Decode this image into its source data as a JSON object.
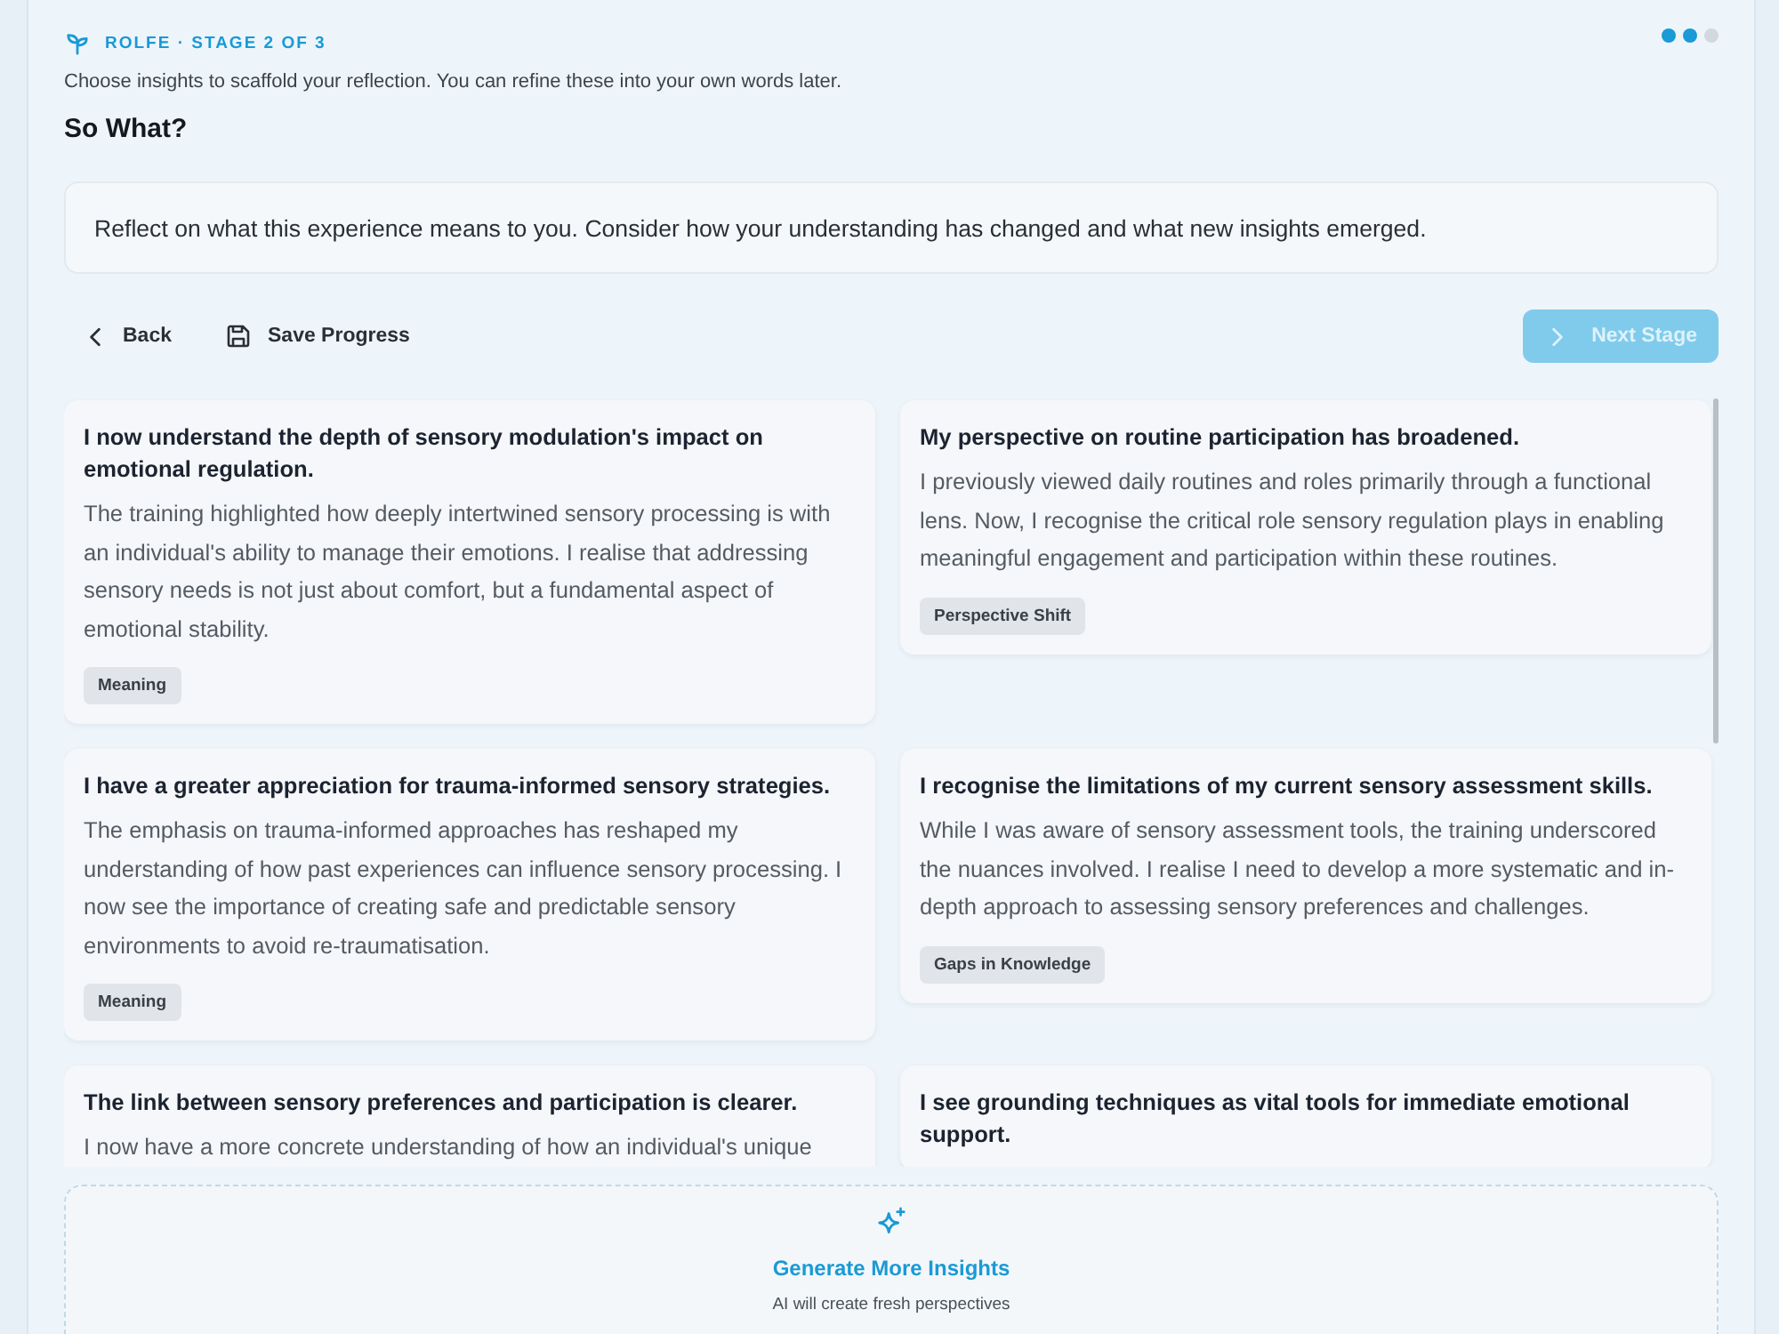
{
  "header": {
    "stage_label": "ROLFE · STAGE 2 OF 3",
    "progress_dots": [
      {
        "filled": true
      },
      {
        "filled": true
      },
      {
        "filled": false
      }
    ],
    "instructions": "Choose insights to scaffold your reflection. You can refine these into your own words later.",
    "title": "So What?"
  },
  "prompt": "Reflect on what this experience means to you. Consider how your understanding has changed and what new insights emerged.",
  "nav": {
    "back": "Back",
    "save": "Save Progress",
    "next": {
      "label": "Next Stage",
      "disabled": true
    }
  },
  "insights": [
    {
      "title": "I now understand the depth of sensory modulation's impact on emotional regulation.",
      "body": "The training highlighted how deeply intertwined sensory processing is with an individual's ability to manage their emotions. I realise that addressing sensory needs is not just about comfort, but a fundamental aspect of emotional stability.",
      "tag": "Meaning"
    },
    {
      "title": "My perspective on routine participation has broadened.",
      "body": "I previously viewed daily routines and roles primarily through a functional lens. Now, I recognise the critical role sensory regulation plays in enabling meaningful engagement and participation within these routines.",
      "tag": "Perspective Shift"
    },
    {
      "title": "I have a greater appreciation for trauma-informed sensory strategies.",
      "body": "The emphasis on trauma-informed approaches has reshaped my understanding of how past experiences can influence sensory processing. I now see the importance of creating safe and predictable sensory environments to avoid re-traumatisation.",
      "tag": "Meaning"
    },
    {
      "title": "I recognise the limitations of my current sensory assessment skills.",
      "body": "While I was aware of sensory assessment tools, the training underscored the nuances involved. I realise I need to develop a more systematic and in-depth approach to assessing sensory preferences and challenges.",
      "tag": "Gaps in Knowledge"
    },
    {
      "title": "The link between sensory preferences and participation is clearer.",
      "body": "I now have a more concrete understanding of how an individual's unique"
    },
    {
      "title": "I see grounding techniques as vital tools for immediate emotional support."
    }
  ],
  "generate": {
    "label": "Generate More Insights",
    "caption": "AI will create fresh perspectives"
  }
}
